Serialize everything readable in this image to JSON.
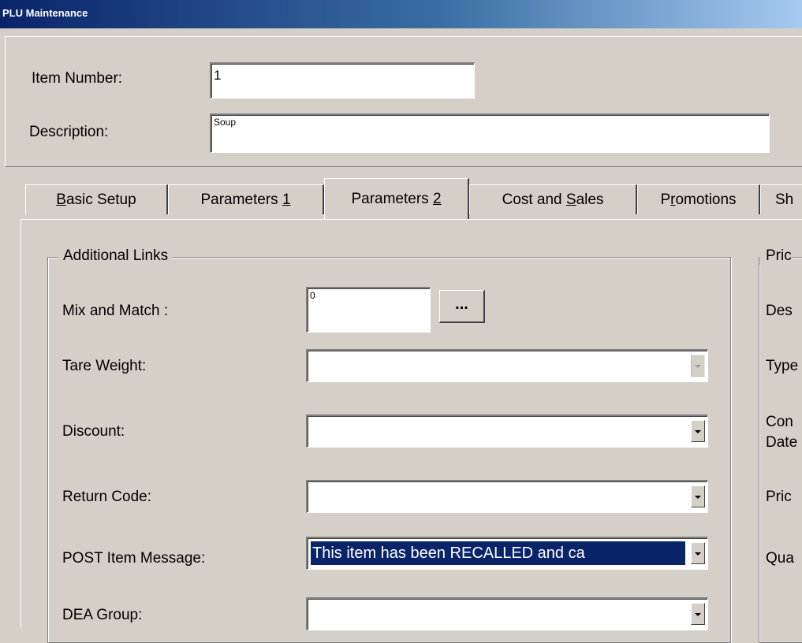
{
  "window": {
    "title": "PLU Maintenance"
  },
  "header": {
    "item_number_label": "Item Number:",
    "item_number_value": "1",
    "description_label": "Description:",
    "description_value": "Soup"
  },
  "tabs": [
    {
      "label_pre": "",
      "mnemonic": "B",
      "label_post": "asic Setup",
      "active": false
    },
    {
      "label_pre": "Parameters ",
      "mnemonic": "1",
      "label_post": "",
      "active": false
    },
    {
      "label_pre": "Parameters ",
      "mnemonic": "2",
      "label_post": "",
      "active": true
    },
    {
      "label_pre": "Cost and ",
      "mnemonic": "S",
      "label_post": "ales",
      "active": false
    },
    {
      "label_pre": "P",
      "mnemonic": "r",
      "label_post": "omotions",
      "active": false
    },
    {
      "label_pre": "Sh",
      "mnemonic": "",
      "label_post": "",
      "active": false
    }
  ],
  "additional_links": {
    "group_title": "Additional Links",
    "mix_and_match_label": "Mix and Match :",
    "mix_and_match_value": "0",
    "mix_and_match_button": "...",
    "tare_weight_label": "Tare Weight:",
    "tare_weight_value": "",
    "discount_label": "Discount:",
    "discount_value": "",
    "return_code_label": "Return Code:",
    "return_code_value": "",
    "post_item_message_label": "POST Item Message:",
    "post_item_message_value": "This item has been  RECALLED and ca",
    "dea_group_label": "DEA Group:",
    "dea_group_value": ""
  },
  "price_group": {
    "group_title": "Pric",
    "labels": [
      "Des",
      "Type",
      "Con",
      "Date",
      "Pric",
      "Qua"
    ]
  },
  "colors": {
    "face": "#d4d0c8",
    "title_start": "#0a246a",
    "title_end": "#a6caf0",
    "selection": "#0a246a"
  }
}
